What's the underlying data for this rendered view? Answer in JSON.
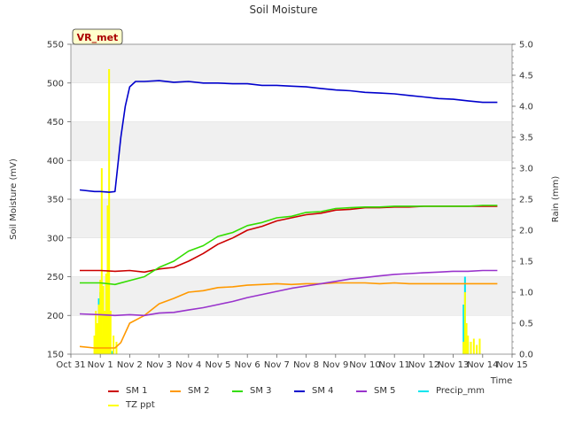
{
  "chart_data": {
    "type": "line",
    "title": "Soil Moisture",
    "xlabel": "Time",
    "ylabel": "Soil Moisture (mV)",
    "y2label": "Rain (mm)",
    "ylim": [
      150,
      550
    ],
    "y2lim": [
      0.0,
      5.0
    ],
    "xlim": [
      0,
      15
    ],
    "station_label": "VR_met",
    "x_ticks": [
      {
        "x": 0,
        "label": "Oct 31"
      },
      {
        "x": 1,
        "label": "Nov 1"
      },
      {
        "x": 2,
        "label": "Nov 2"
      },
      {
        "x": 3,
        "label": "Nov 3"
      },
      {
        "x": 4,
        "label": "Nov 4"
      },
      {
        "x": 5,
        "label": "Nov 5"
      },
      {
        "x": 6,
        "label": "Nov 6"
      },
      {
        "x": 7,
        "label": "Nov 7"
      },
      {
        "x": 8,
        "label": "Nov 8"
      },
      {
        "x": 9,
        "label": "Nov 9"
      },
      {
        "x": 10,
        "label": "Nov 10"
      },
      {
        "x": 11,
        "label": "Nov 11"
      },
      {
        "x": 12,
        "label": "Nov 12"
      },
      {
        "x": 13,
        "label": "Nov 13"
      },
      {
        "x": 14,
        "label": "Nov 14"
      },
      {
        "x": 15,
        "label": "Nov 15"
      }
    ],
    "y_ticks": [
      150,
      200,
      250,
      300,
      350,
      400,
      450,
      500,
      550
    ],
    "y2_ticks": [
      "0.0",
      "0.5",
      "1.0",
      "1.5",
      "2.0",
      "2.5",
      "3.0",
      "3.5",
      "4.0",
      "4.5",
      "5.0"
    ],
    "grid": true,
    "legend_position": "bottom",
    "series": [
      {
        "name": "SM 1",
        "color": "#cc0000",
        "axis": "left",
        "x": [
          0.3,
          1.0,
          1.5,
          2.0,
          2.5,
          3.0,
          3.5,
          4.0,
          4.5,
          5.0,
          5.5,
          6.0,
          6.5,
          7.0,
          7.5,
          8.0,
          8.5,
          9.0,
          9.5,
          10.0,
          10.5,
          11.0,
          11.5,
          12.0,
          12.5,
          13.0,
          13.5,
          14.0,
          14.5
        ],
        "y": [
          258,
          258,
          257,
          258,
          256,
          260,
          262,
          270,
          280,
          292,
          300,
          310,
          315,
          322,
          326,
          330,
          332,
          336,
          337,
          339,
          339,
          340,
          340,
          341,
          341,
          341,
          341,
          341,
          341
        ]
      },
      {
        "name": "SM 2",
        "color": "#ff9900",
        "axis": "left",
        "x": [
          0.3,
          0.8,
          1.0,
          1.5,
          1.7,
          2.0,
          2.5,
          3.0,
          3.5,
          4.0,
          4.5,
          5.0,
          5.5,
          6.0,
          6.5,
          7.0,
          7.5,
          8.0,
          8.5,
          9.0,
          9.5,
          10.0,
          10.5,
          11.0,
          11.5,
          12.0,
          12.5,
          13.0,
          13.5,
          14.0,
          14.5
        ],
        "y": [
          160,
          158,
          158,
          158,
          165,
          190,
          200,
          215,
          222,
          230,
          232,
          236,
          237,
          239,
          240,
          241,
          240,
          241,
          241,
          242,
          242,
          242,
          241,
          242,
          241,
          241,
          241,
          241,
          241,
          241,
          241
        ]
      },
      {
        "name": "SM 3",
        "color": "#33dd00",
        "axis": "left",
        "x": [
          0.3,
          1.0,
          1.5,
          2.0,
          2.5,
          3.0,
          3.5,
          4.0,
          4.5,
          5.0,
          5.5,
          6.0,
          6.5,
          7.0,
          7.5,
          8.0,
          8.5,
          9.0,
          9.5,
          10.0,
          10.5,
          11.0,
          11.5,
          12.0,
          12.5,
          13.0,
          13.5,
          14.0,
          14.5
        ],
        "y": [
          242,
          242,
          240,
          245,
          250,
          262,
          270,
          283,
          290,
          302,
          307,
          316,
          320,
          326,
          328,
          333,
          334,
          338,
          339,
          340,
          340,
          341,
          341,
          341,
          341,
          341,
          341,
          342,
          342
        ]
      },
      {
        "name": "SM 4",
        "color": "#0000cc",
        "axis": "left",
        "x": [
          0.3,
          0.8,
          1.0,
          1.3,
          1.5,
          1.7,
          1.85,
          2.0,
          2.2,
          2.5,
          3.0,
          3.5,
          4.0,
          4.5,
          5.0,
          5.5,
          6.0,
          6.5,
          7.0,
          7.5,
          8.0,
          8.5,
          9.0,
          9.5,
          10.0,
          10.5,
          11.0,
          11.5,
          12.0,
          12.5,
          13.0,
          13.5,
          14.0,
          14.5
        ],
        "y": [
          362,
          360,
          360,
          359,
          360,
          430,
          470,
          495,
          502,
          502,
          503,
          501,
          502,
          500,
          500,
          499,
          499,
          497,
          497,
          496,
          495,
          493,
          491,
          490,
          488,
          487,
          486,
          484,
          482,
          480,
          479,
          477,
          475,
          475
        ]
      },
      {
        "name": "SM 5",
        "color": "#9933cc",
        "axis": "left",
        "x": [
          0.3,
          1.0,
          1.5,
          2.0,
          2.5,
          3.0,
          3.5,
          4.0,
          4.5,
          5.0,
          5.5,
          6.0,
          6.5,
          7.0,
          7.5,
          8.0,
          8.5,
          9.0,
          9.5,
          10.0,
          10.5,
          11.0,
          11.5,
          12.0,
          12.5,
          13.0,
          13.5,
          14.0,
          14.5
        ],
        "y": [
          202,
          201,
          200,
          201,
          200,
          203,
          204,
          207,
          210,
          214,
          218,
          223,
          227,
          231,
          235,
          238,
          241,
          244,
          247,
          249,
          251,
          253,
          254,
          255,
          256,
          257,
          257,
          258,
          258
        ]
      },
      {
        "name": "Precip_mm",
        "color": "#00e5ee",
        "axis": "right",
        "style": "spikes",
        "x": [
          0.85,
          0.9,
          0.95,
          1.0,
          1.05,
          1.1,
          1.2,
          1.3,
          1.4,
          13.35,
          13.4,
          13.45,
          13.5
        ],
        "y": [
          0.1,
          0.4,
          0.9,
          1.0,
          0.3,
          0.1,
          0.6,
          0.2,
          0.05,
          0.8,
          1.25,
          0.5,
          0.2
        ]
      },
      {
        "name": "TZ ppt",
        "color": "#ffff00",
        "axis": "right",
        "style": "spikes",
        "x": [
          0.8,
          0.85,
          0.9,
          0.95,
          1.0,
          1.05,
          1.1,
          1.15,
          1.2,
          1.25,
          1.3,
          1.35,
          1.45,
          1.55,
          13.35,
          13.4,
          13.45,
          13.5,
          13.6,
          13.7,
          13.8,
          13.9
        ],
        "y": [
          0.3,
          0.7,
          0.5,
          0.8,
          1.2,
          3.0,
          1.1,
          0.7,
          1.3,
          2.4,
          4.6,
          0.7,
          0.3,
          0.2,
          0.2,
          1.0,
          0.5,
          0.3,
          0.2,
          0.25,
          0.15,
          0.25
        ]
      }
    ]
  }
}
